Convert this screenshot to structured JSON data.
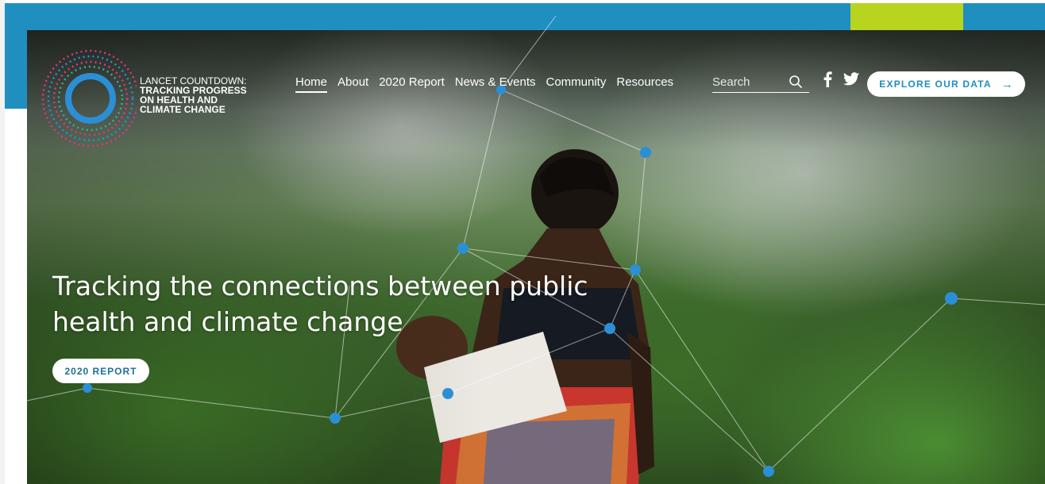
{
  "brand": {
    "line1": "LANCET COUNTDOWN:",
    "line2": "TRACKING PROGRESS",
    "line3": "ON HEALTH AND",
    "line4": "CLIMATE CHANGE"
  },
  "nav": {
    "items": [
      {
        "label": "Home",
        "active": true
      },
      {
        "label": "About"
      },
      {
        "label": "2020 Report"
      },
      {
        "label": "News & Events"
      },
      {
        "label": "Community"
      },
      {
        "label": "Resources"
      }
    ]
  },
  "search": {
    "placeholder": "Search",
    "icon": "search-icon"
  },
  "social": {
    "facebook_icon": "facebook-icon",
    "twitter_icon": "twitter-icon"
  },
  "cta": {
    "label": "EXPLORE OUR DATA",
    "arrow": "→"
  },
  "hero": {
    "headline_line1": "Tracking the connections between public",
    "headline_line2": "health and climate change",
    "report_button": "2020 REPORT"
  },
  "colors": {
    "accent_blue": "#1f8fc0",
    "accent_lime": "#b8d41e",
    "node_blue": "#2b8fd6"
  }
}
